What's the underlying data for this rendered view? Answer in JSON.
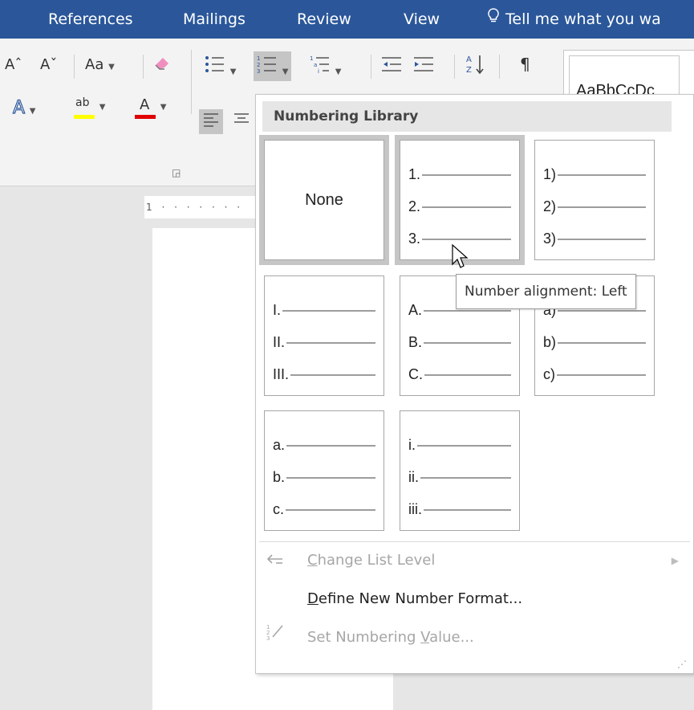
{
  "tabs": [
    "References",
    "Mailings",
    "Review",
    "View"
  ],
  "tell_me": "Tell me what you wa",
  "ribbon": {
    "grow_font": "Aˆ",
    "shrink_font": "Aˇ",
    "change_case": "Aa",
    "styles_preview": "AaBbCcDc"
  },
  "ruler_text": "1 · · · · · · ·",
  "dropdown": {
    "header": "Numbering Library",
    "none_label": "None",
    "formats": [
      [
        "1.",
        "2.",
        "3."
      ],
      [
        "1)",
        "2)",
        "3)"
      ],
      [
        "I.",
        "II.",
        "III."
      ],
      [
        "A.",
        "B.",
        "C."
      ],
      [
        "a)",
        "b)",
        "c)"
      ],
      [
        "a.",
        "b.",
        "c."
      ],
      [
        "i.",
        "ii.",
        "iii."
      ]
    ],
    "menu": {
      "change_list_level_pre": "",
      "change_list_level_u": "C",
      "change_list_level_post": "hange List Level",
      "define_pre": "",
      "define_u": "D",
      "define_post": "efine New Number Format...",
      "set_value_pre": "Set Numbering ",
      "set_value_u": "V",
      "set_value_post": "alue..."
    }
  },
  "tooltip": "Number alignment: Left",
  "colors": {
    "tabbar": "#2b579a",
    "highlight_yellow": "#ffff00",
    "font_color_red": "#e00000"
  }
}
